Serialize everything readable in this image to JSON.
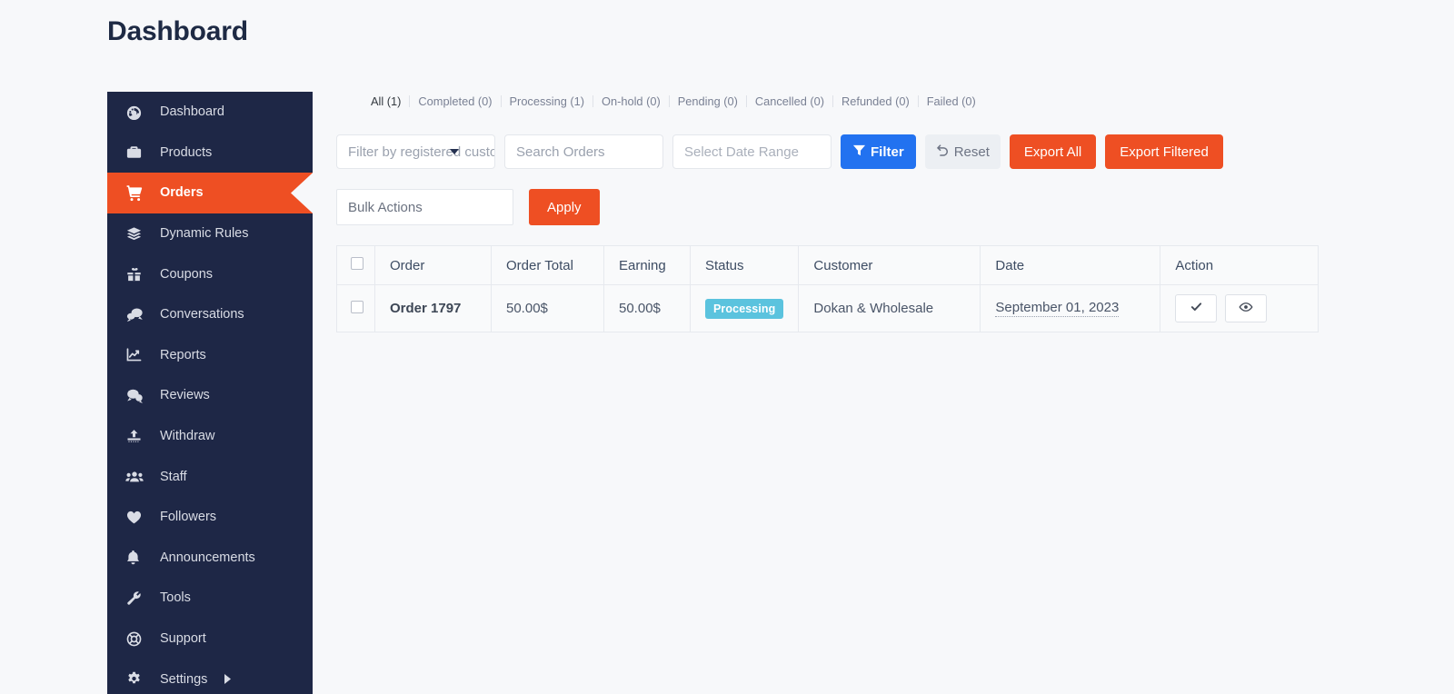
{
  "page": {
    "title": "Dashboard"
  },
  "sidebar": {
    "items": [
      {
        "label": "Dashboard",
        "icon": "gauge-icon",
        "active": false,
        "submenu": false
      },
      {
        "label": "Products",
        "icon": "briefcase-icon",
        "active": false,
        "submenu": false
      },
      {
        "label": "Orders",
        "icon": "cart-icon",
        "active": true,
        "submenu": false
      },
      {
        "label": "Dynamic Rules",
        "icon": "layers-icon",
        "active": false,
        "submenu": false
      },
      {
        "label": "Coupons",
        "icon": "gift-icon",
        "active": false,
        "submenu": false
      },
      {
        "label": "Conversations",
        "icon": "chat-bubbles-icon",
        "active": false,
        "submenu": false
      },
      {
        "label": "Reports",
        "icon": "chart-line-icon",
        "active": false,
        "submenu": false
      },
      {
        "label": "Reviews",
        "icon": "comment-dots-icon",
        "active": false,
        "submenu": false
      },
      {
        "label": "Withdraw",
        "icon": "upload-icon",
        "active": false,
        "submenu": false
      },
      {
        "label": "Staff",
        "icon": "users-icon",
        "active": false,
        "submenu": false
      },
      {
        "label": "Followers",
        "icon": "heart-icon",
        "active": false,
        "submenu": false
      },
      {
        "label": "Announcements",
        "icon": "bell-icon",
        "active": false,
        "submenu": false
      },
      {
        "label": "Tools",
        "icon": "wrench-icon",
        "active": false,
        "submenu": false
      },
      {
        "label": "Support",
        "icon": "lifebuoy-icon",
        "active": false,
        "submenu": false
      },
      {
        "label": "Settings",
        "icon": "gear-icon",
        "active": false,
        "submenu": true
      }
    ]
  },
  "status_tabs": [
    {
      "label": "All (1)",
      "active": true
    },
    {
      "label": "Completed (0)",
      "active": false
    },
    {
      "label": "Processing (1)",
      "active": false
    },
    {
      "label": "On-hold (0)",
      "active": false
    },
    {
      "label": "Pending (0)",
      "active": false
    },
    {
      "label": "Cancelled (0)",
      "active": false
    },
    {
      "label": "Refunded (0)",
      "active": false
    },
    {
      "label": "Failed (0)",
      "active": false
    }
  ],
  "filters": {
    "customer_placeholder": "Filter by registered customer",
    "customer_value": "",
    "search_placeholder": "Search Orders",
    "search_value": "",
    "date_placeholder": "Select Date Range",
    "date_value": "",
    "filter_label": "Filter",
    "reset_label": "Reset",
    "export_all_label": "Export All",
    "export_filtered_label": "Export Filtered"
  },
  "bulk": {
    "select_value": "Bulk Actions",
    "apply_label": "Apply"
  },
  "table": {
    "columns": [
      "Order",
      "Order Total",
      "Earning",
      "Status",
      "Customer",
      "Date",
      "Action"
    ],
    "rows": [
      {
        "order": "Order 1797",
        "order_total": "50.00$",
        "earning": "50.00$",
        "status": "Processing",
        "customer": "Dokan & Wholesale",
        "date": "September 01, 2023"
      }
    ]
  },
  "colors": {
    "sidebar_bg": "#1e2746",
    "accent_orange": "#ee4f23",
    "filter_blue": "#2272f0",
    "status_badge": "#5bc3de",
    "page_bg": "#f7f8fa"
  }
}
